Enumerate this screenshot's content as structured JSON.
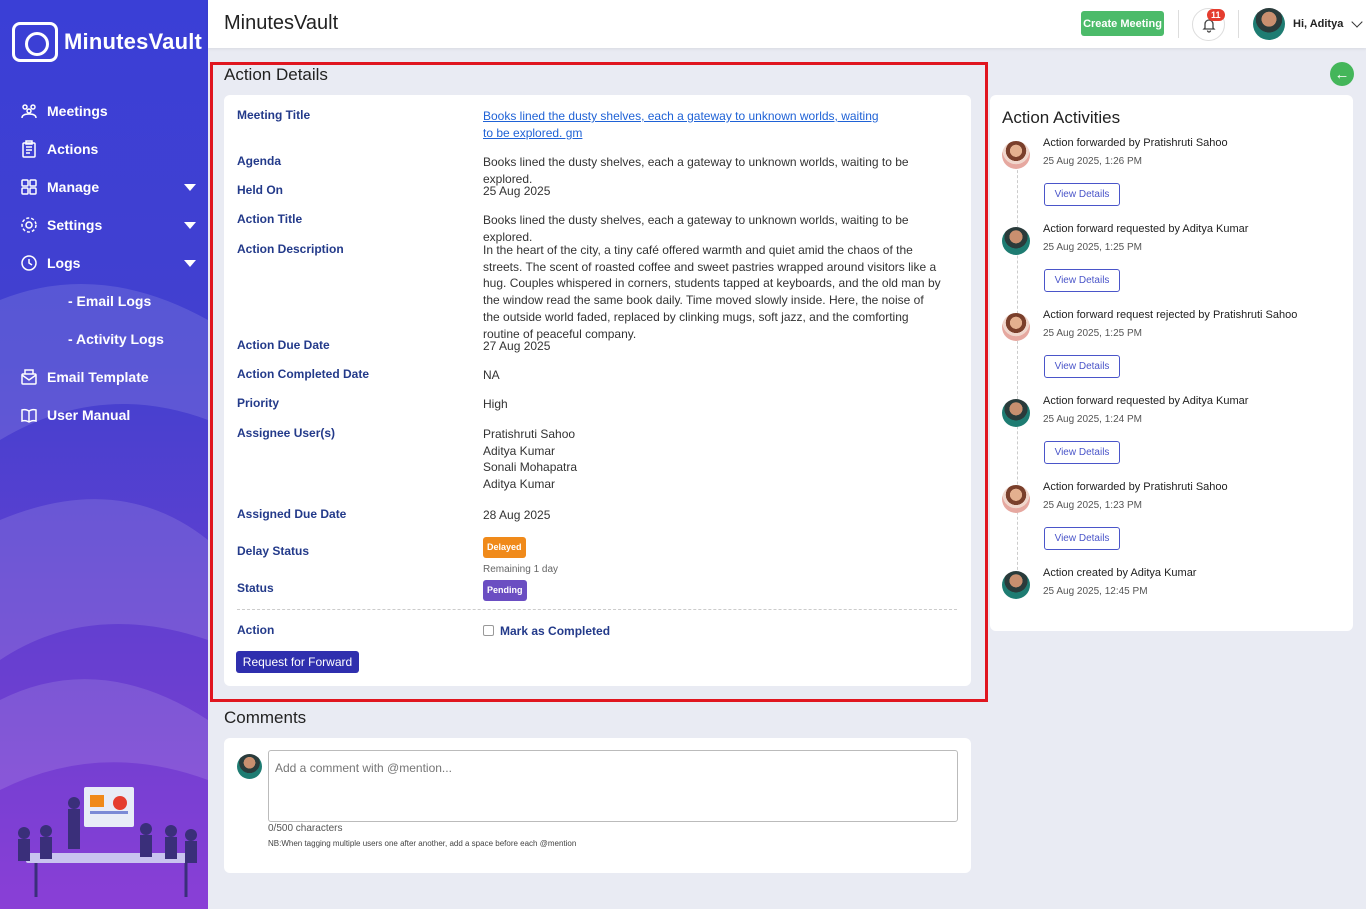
{
  "app": {
    "brand": "MinutesVault",
    "title": "MinutesVault"
  },
  "topbar": {
    "create_label": "Create Meeting",
    "notif_count": "11",
    "greeting": "Hi, Aditya"
  },
  "sidebar": {
    "items": [
      {
        "label": "Meetings"
      },
      {
        "label": "Actions"
      },
      {
        "label": "Manage"
      },
      {
        "label": "Settings"
      },
      {
        "label": "Logs"
      },
      {
        "label": "- Email Logs"
      },
      {
        "label": "- Activity Logs"
      },
      {
        "label": "Email Template"
      },
      {
        "label": "User Manual"
      }
    ]
  },
  "details": {
    "section_title": "Action Details",
    "meeting_title_label": "Meeting Title",
    "meeting_title_value": "Books lined the dusty shelves, each a gateway to unknown worlds, waiting to be explored. gm",
    "agenda_label": "Agenda",
    "agenda_value": "Books lined the dusty shelves, each a gateway to unknown worlds, waiting to be explored.",
    "held_on_label": "Held On",
    "held_on_value": "25 Aug 2025",
    "action_title_label": "Action Title",
    "action_title_value": "Books lined the dusty shelves, each a gateway to unknown worlds, waiting to be explored.",
    "description_label": "Action Description",
    "description_value": "In the heart of the city, a tiny café offered warmth and quiet amid the chaos of the streets. The scent of roasted coffee and sweet pastries wrapped around visitors like a hug. Couples whispered in corners, students tapped at keyboards, and the old man by the window read the same book daily. Time moved slowly inside. Here, the noise of the outside world faded, replaced by clinking mugs, soft jazz, and the comforting routine of peaceful company.",
    "due_date_label": "Action Due Date",
    "due_date_value": "27 Aug 2025",
    "completed_label": "Action Completed Date",
    "completed_value": "NA",
    "priority_label": "Priority",
    "priority_value": "High",
    "assignees_label": "Assignee User(s)",
    "assignees": [
      "Pratishruti Sahoo",
      "Aditya Kumar",
      "Sonali Mohapatra",
      "Aditya Kumar"
    ],
    "assigned_due_label": "Assigned Due Date",
    "assigned_due_value": "28 Aug 2025",
    "delay_label": "Delay Status",
    "delay_badge": "Delayed",
    "delay_remaining": "Remaining 1 day",
    "status_label": "Status",
    "status_badge": "Pending",
    "action_label": "Action",
    "mark_completed": "Mark as Completed",
    "request_forward": "Request for Forward"
  },
  "comments": {
    "title": "Comments",
    "placeholder": "Add a comment with @mention...",
    "chars": "0/500 characters",
    "note": "NB:When tagging multiple users one after another, add a space before each @mention"
  },
  "activities": {
    "title": "Action Activities",
    "view_label": "View Details",
    "items": [
      {
        "text": "Action forwarded by Pratishruti Sahoo",
        "time": "25 Aug 2025, 1:26 PM"
      },
      {
        "text": "Action forward requested by Aditya Kumar",
        "time": "25 Aug 2025, 1:25 PM"
      },
      {
        "text": "Action forward request rejected by Pratishruti Sahoo",
        "time": "25 Aug 2025, 1:25 PM"
      },
      {
        "text": "Action forward requested by Aditya Kumar",
        "time": "25 Aug 2025, 1:24 PM"
      },
      {
        "text": "Action forwarded by Pratishruti Sahoo",
        "time": "25 Aug 2025, 1:23 PM"
      },
      {
        "text": "Action created by Aditya Kumar",
        "time": "25 Aug 2025, 12:45 PM"
      }
    ]
  },
  "colors": {
    "accent": "#2f2fae",
    "success": "#4cbb6a",
    "highlight": "#e0161f",
    "delayed": "#f08a1a",
    "pending": "#6b4ec2"
  }
}
